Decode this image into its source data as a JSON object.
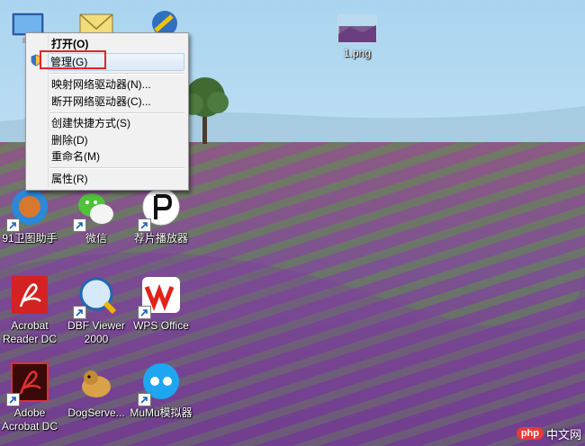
{
  "desktop": {
    "icons": [
      {
        "name": "network-computer",
        "label": "",
        "icon": "computer-icon"
      },
      {
        "name": "mail",
        "label": "",
        "icon": "envelope-icon"
      },
      {
        "name": "tool",
        "label": "",
        "icon": "wrench-icon"
      },
      {
        "name": "png-file",
        "label": "1.png",
        "icon": "image-file-icon"
      },
      {
        "name": "91-helper",
        "label": "91卫图助手",
        "icon": "helper-app-icon"
      },
      {
        "name": "wechat",
        "label": "微信",
        "icon": "wechat-icon"
      },
      {
        "name": "player",
        "label": "荐片播放器",
        "icon": "player-icon"
      },
      {
        "name": "acrobat-reader",
        "label": "Acrobat Reader DC",
        "icon": "acrobat-reader-icon"
      },
      {
        "name": "dbf-viewer",
        "label": "DBF Viewer 2000",
        "icon": "dbf-viewer-icon"
      },
      {
        "name": "wps-office",
        "label": "WPS Office",
        "icon": "wps-office-icon"
      },
      {
        "name": "adobe-acrobat",
        "label": "Adobe Acrobat DC",
        "icon": "adobe-acrobat-icon"
      },
      {
        "name": "dogserver",
        "label": "DogServe...",
        "icon": "dog-icon"
      },
      {
        "name": "mumu",
        "label": "MuMu模拟器",
        "icon": "mumu-icon"
      }
    ]
  },
  "context_menu": {
    "items": [
      {
        "label": "打开(O)",
        "default": true
      },
      {
        "label": "管理(G)",
        "highlighted": true,
        "icon": "shield-icon"
      },
      {
        "label": "映射网络驱动器(N)..."
      },
      {
        "label": "断开网络驱动器(C)..."
      },
      {
        "label": "创建快捷方式(S)"
      },
      {
        "label": "删除(D)"
      },
      {
        "label": "重命名(M)"
      },
      {
        "label": "属性(R)"
      }
    ]
  },
  "watermark": {
    "logo": "php",
    "text": "中文网"
  },
  "colors": {
    "sky": "#bcdff5",
    "lavender": "#7a4f8f",
    "highlight_box": "#e0232b"
  }
}
